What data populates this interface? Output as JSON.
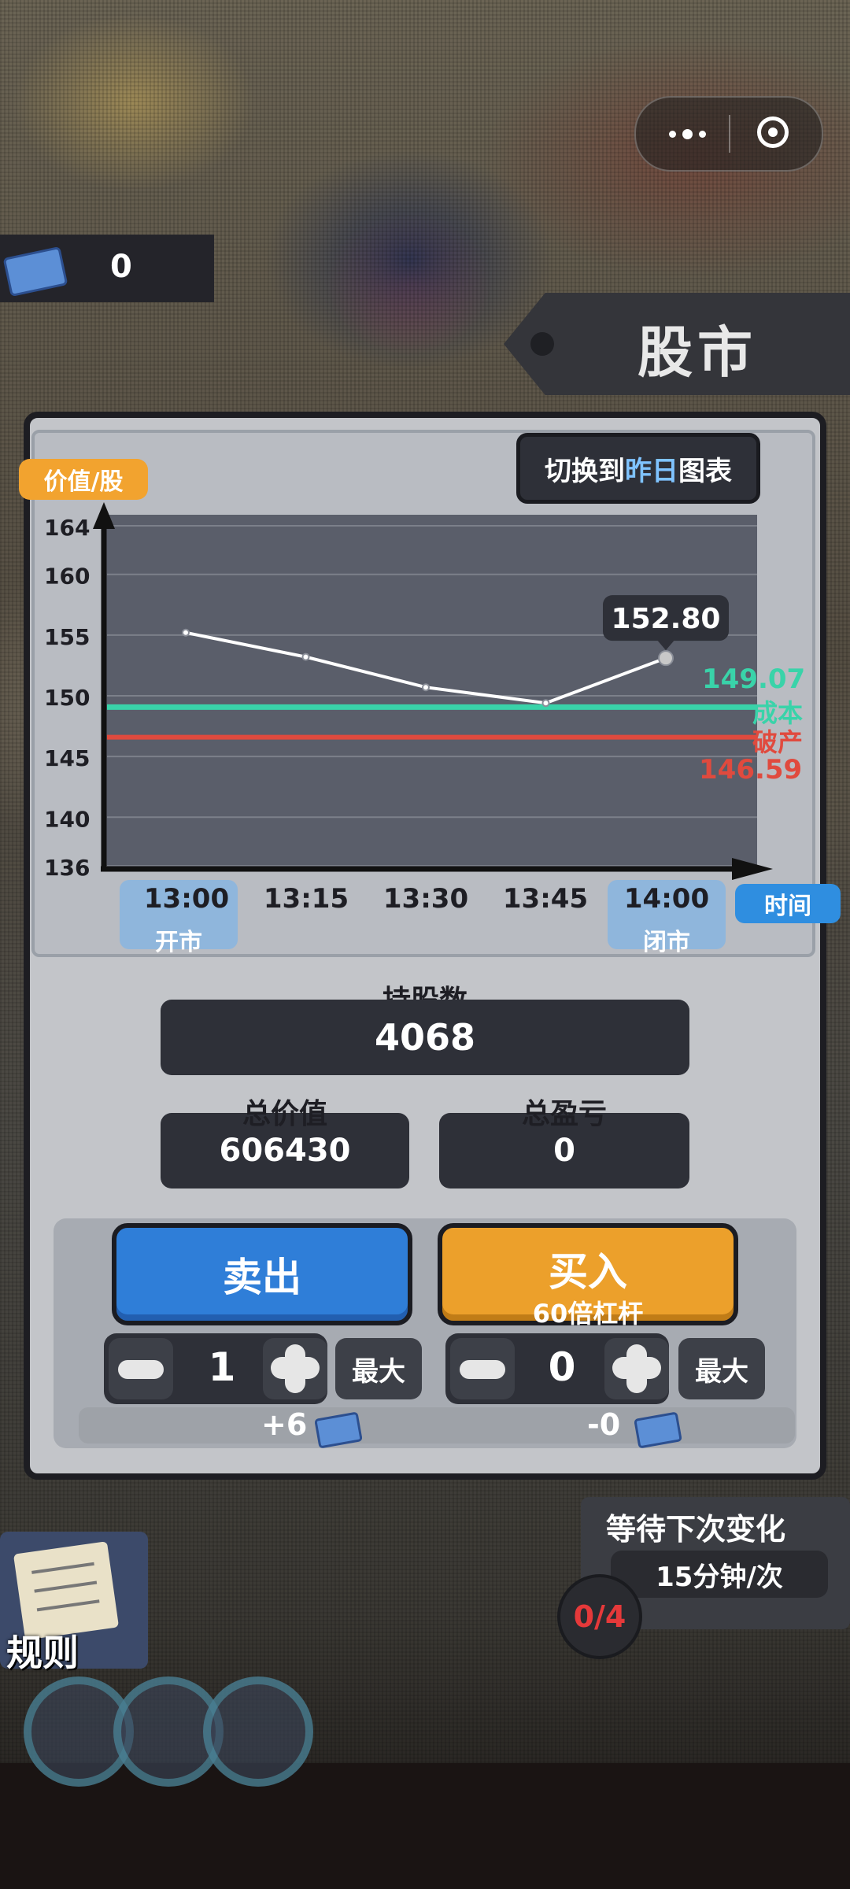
{
  "top_currency": {
    "amount": "0",
    "icon": "banknote-icon"
  },
  "header": {
    "title": "股市"
  },
  "capsule": {
    "more_icon": "more-dots-icon",
    "close_icon": "target-circle-icon"
  },
  "chart_toggle": {
    "prefix": "切换到",
    "highlight": "昨日",
    "suffix": "图表"
  },
  "colors": {
    "cost": "#39d3a9",
    "bankrupt": "#e04a3e",
    "line": "#ffffff",
    "sell": "#2f7ed8",
    "buy": "#eca02b",
    "plot_bg": "#5a5e6a"
  },
  "chart_data": {
    "type": "line",
    "ylabel": "价值/股",
    "xlabel": "时间",
    "y_ticks": [
      136,
      140,
      145,
      150,
      155,
      160,
      164
    ],
    "ylim": [
      136,
      164
    ],
    "x": [
      "13:00",
      "13:15",
      "13:30",
      "13:45",
      "14:00"
    ],
    "x_sub": {
      "13:00": "开市",
      "14:00": "闭市"
    },
    "series": [
      {
        "values": [
          155.2,
          153.2,
          150.7,
          149.4,
          153.1
        ]
      }
    ],
    "current_value": "152.80",
    "reference_lines": [
      {
        "label": "成本",
        "value": 149.07,
        "display": "149.07"
      },
      {
        "label": "破产",
        "value": 146.59,
        "display": "146.59"
      }
    ]
  },
  "stats": {
    "shares_label": "持股数",
    "shares_value": "4068",
    "total_value_label": "总价值",
    "total_value": "606430",
    "pnl_label": "总盈亏",
    "pnl_value": "0"
  },
  "trade": {
    "sell_label": "卖出",
    "buy_label": "买入",
    "buy_sub": "60倍杠杆",
    "sell_qty": "1",
    "buy_qty": "0",
    "max_label": "最大",
    "sell_gain": "+6",
    "buy_cost": "-0"
  },
  "wait": {
    "title": "等待下次变化",
    "freq": "15分钟/次",
    "progress": "0/4"
  },
  "rules": {
    "label": "规则"
  }
}
